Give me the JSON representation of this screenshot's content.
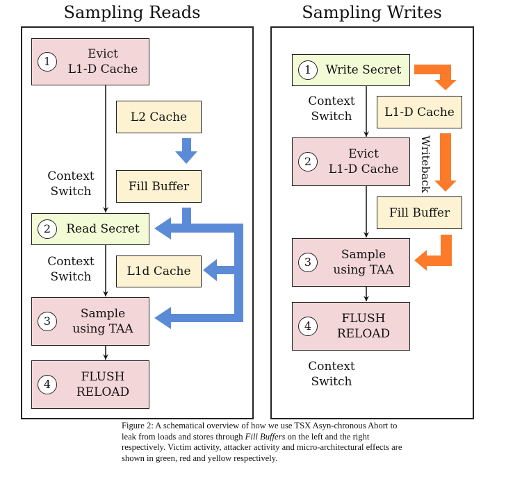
{
  "colors": {
    "attacker_red": "#f3d6d8",
    "victim_green": "#f2fad6",
    "micro_yellow": "#fdf3d3",
    "reads_arrow_blue": "#5b8bd6",
    "writes_arrow_orange": "#fb7b2a"
  },
  "reads": {
    "title": "Sampling Reads",
    "steps": [
      {
        "num": "1",
        "line1": "Evict",
        "line2": "L1-D Cache"
      },
      {
        "num": "2",
        "line1": "Read Secret",
        "line2": ""
      },
      {
        "num": "3",
        "line1": "Sample",
        "line2": "using TAA"
      },
      {
        "num": "4",
        "line1": "FLUSH",
        "line2": "RELOAD"
      }
    ],
    "effects": [
      "L2 Cache",
      "Fill Buffer",
      "L1d Cache"
    ],
    "context_switch_1": {
      "line1": "Context",
      "line2": "Switch"
    },
    "context_switch_2": {
      "line1": "Context",
      "line2": "Switch"
    }
  },
  "writes": {
    "title": "Sampling Writes",
    "steps": [
      {
        "num": "1",
        "line1": "Write Secret",
        "line2": ""
      },
      {
        "num": "2",
        "line1": "Evict",
        "line2": "L1-D Cache"
      },
      {
        "num": "3",
        "line1": "Sample",
        "line2": "using TAA"
      },
      {
        "num": "4",
        "line1": "FLUSH",
        "line2": "RELOAD"
      }
    ],
    "effects": [
      "L1-D Cache",
      "Fill Buffer"
    ],
    "writeback_label": "Writeback",
    "context_switch_1": {
      "line1": "Context",
      "line2": "Switch"
    },
    "context_switch_2": {
      "line1": "Context",
      "line2": "Switch"
    }
  },
  "caption": {
    "part1": "Figure 2: A schematical overview of how we use TSX Asyn-chronous Abort to leak from loads and stores through ",
    "italic1": "Fill Buffers",
    "part2": " on the left and the right respectively. Victim activity, attacker activity and micro-architectural effects are shown in green, red and yellow respectively."
  }
}
